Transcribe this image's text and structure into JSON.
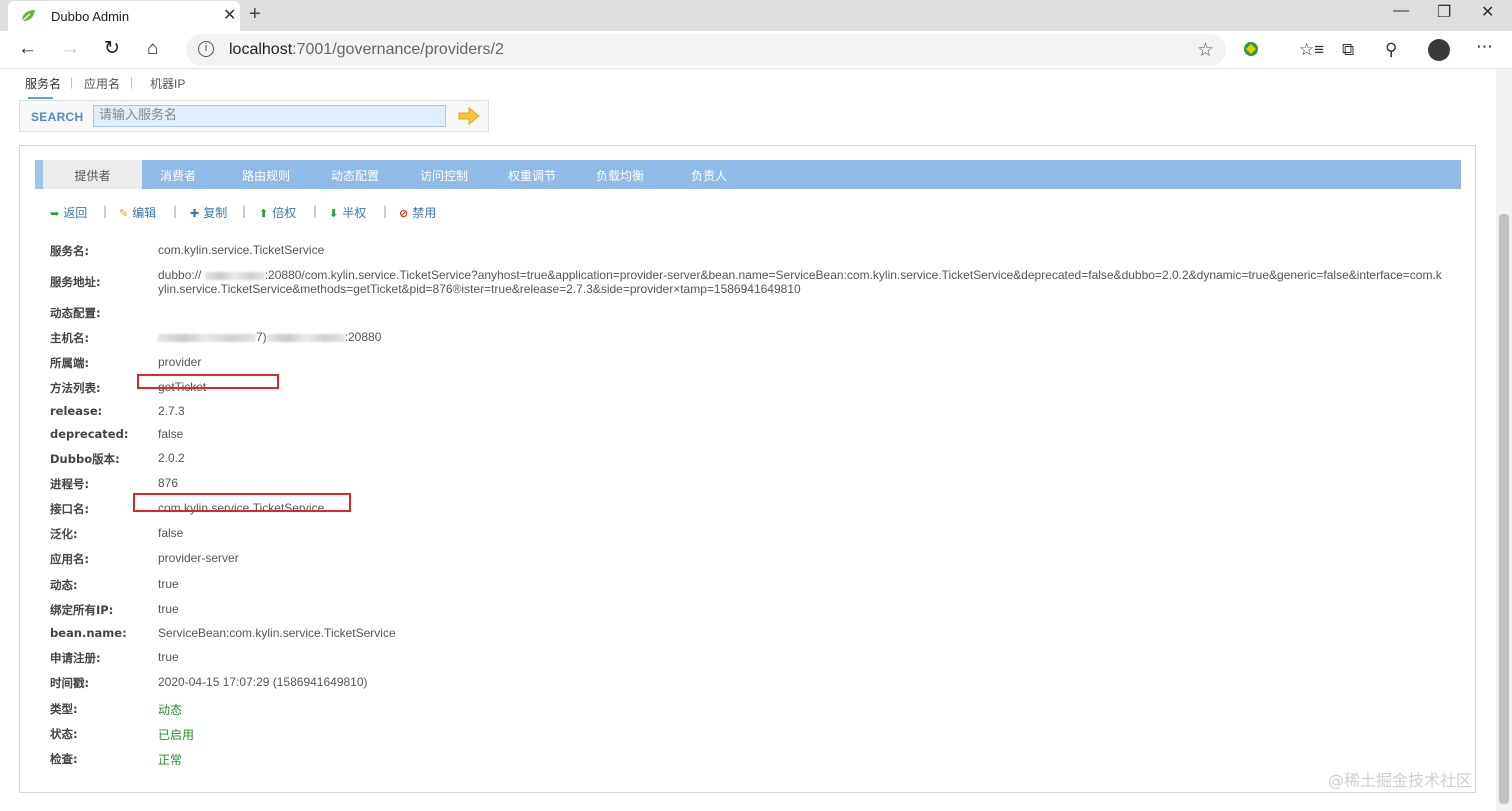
{
  "browser": {
    "tab_title": "Dubbo Admin",
    "url_host": "localhost",
    "url_path": ":7001/governance/providers/2"
  },
  "topnav": {
    "items": [
      "服务名",
      "应用名",
      "机器IP"
    ],
    "separator": "|"
  },
  "search": {
    "label": "SEARCH",
    "placeholder": "请输入服务名"
  },
  "tabs": [
    "提供者",
    "消费者",
    "路由规则",
    "动态配置",
    "访问控制",
    "权重调节",
    "负载均衡",
    "负责人"
  ],
  "actions": [
    "返回",
    "编辑",
    "复制",
    "倍权",
    "半权",
    "禁用"
  ],
  "details": [
    {
      "key": "服务名:",
      "value": "com.kylin.service.TicketService"
    },
    {
      "key": "服务地址:",
      "value_prefix": "dubbo://",
      "value_suffix": ":20880/com.kylin.service.TicketService?anyhost=true&application=provider-server&bean.name=ServiceBean:com.kylin.service.TicketService&deprecated=false&dubbo=2.0.2&dynamic=true&generic=false&interface=com.kylin.service.TicketService&methods=getTicket&pid=876®ister=true&release=2.7.3&side=provider×tamp=1586941649810"
    },
    {
      "key": "动态配置:",
      "value": ""
    },
    {
      "key": "主机名:",
      "value_mid": "7)",
      "value_suffix": ":20880"
    },
    {
      "key": "所属端:",
      "value": "provider"
    },
    {
      "key": "方法列表:",
      "value": "getTicket"
    },
    {
      "key": "release:",
      "value": "2.7.3"
    },
    {
      "key": "deprecated:",
      "value": "false"
    },
    {
      "key": "Dubbo版本:",
      "value": "2.0.2"
    },
    {
      "key": "进程号:",
      "value": "876"
    },
    {
      "key": "接口名:",
      "value": "com.kylin.service.TicketService"
    },
    {
      "key": "泛化:",
      "value": "false"
    },
    {
      "key": "应用名:",
      "value": "provider-server"
    },
    {
      "key": "动态:",
      "value": "true"
    },
    {
      "key": "绑定所有IP:",
      "value": "true"
    },
    {
      "key": "bean.name:",
      "value": "ServiceBean:com.kylin.service.TicketService"
    },
    {
      "key": "申请注册:",
      "value": "true"
    },
    {
      "key": "时间戳:",
      "value": "2020-04-15 17:07:29 (1586941649810)"
    },
    {
      "key": "类型:",
      "value": "动态"
    },
    {
      "key": "状态:",
      "value": "已启用"
    },
    {
      "key": "检查:",
      "value": "正常"
    }
  ],
  "watermark": "@稀土掘金技术社区",
  "colors": {
    "tab_bar": "#8fbbe6",
    "link": "#3a78b5",
    "status_green": "#2a8f2a",
    "highlight_box": "#e1252b"
  }
}
